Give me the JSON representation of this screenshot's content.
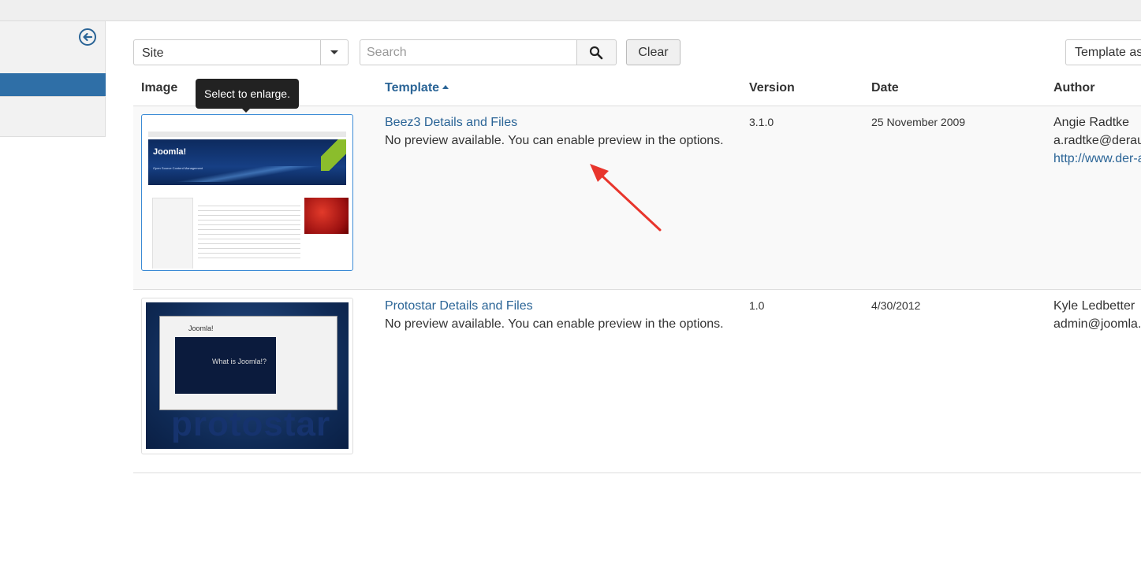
{
  "filters": {
    "client_value": "Site",
    "search_placeholder": "Search",
    "clear_label": "Clear",
    "template_assign_label": "Template as"
  },
  "columns": {
    "image": "Image",
    "template": "Template",
    "version": "Version",
    "date": "Date",
    "author": "Author"
  },
  "tooltip": "Select to enlarge.",
  "rows": [
    {
      "title": "Beez3 Details and Files",
      "description": "No preview available. You can enable preview in the options.",
      "version": "3.1.0",
      "date": "25 November 2009",
      "author_name": "Angie Radtke",
      "author_email": "a.radtke@derau",
      "author_url": "http://www.der-a",
      "thumb_logo": "Joomla!",
      "thumb_sub": "Open Source Content Management"
    },
    {
      "title": "Protostar Details and Files",
      "description": "No preview available. You can enable preview in the options.",
      "version": "1.0",
      "date": "4/30/2012",
      "author_name": "Kyle Ledbetter",
      "author_email": "admin@joomla.",
      "thumb_brand": "protostar",
      "thumb_logo": "Joomla!",
      "thumb_video": "What is Joomla!?"
    }
  ],
  "colors": {
    "link": "#2a6496",
    "sidebar_active": "#2f6fa7",
    "annotation_arrow": "#e8352c"
  }
}
